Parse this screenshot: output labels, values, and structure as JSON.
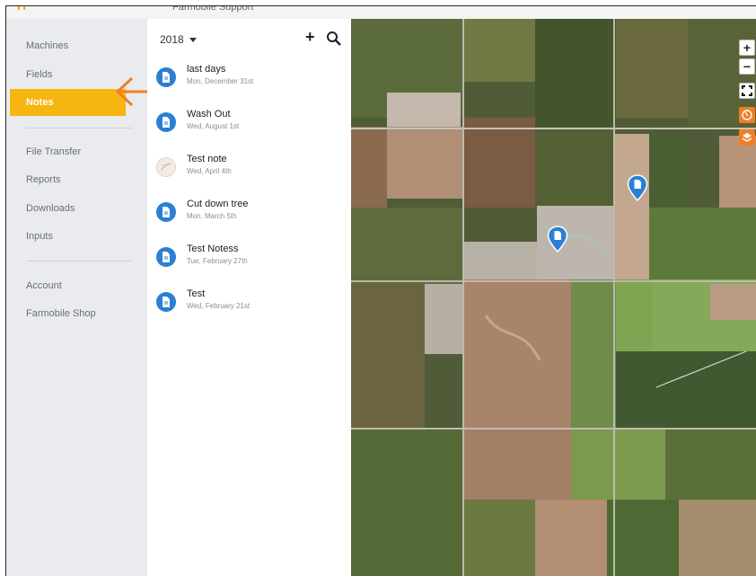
{
  "app": {
    "header_title": "Farmobile Support"
  },
  "sidebar": {
    "items": [
      {
        "label": "Machines"
      },
      {
        "label": "Fields"
      },
      {
        "label": "Notes"
      },
      {
        "label": "File Transfer"
      },
      {
        "label": "Reports"
      },
      {
        "label": "Downloads"
      },
      {
        "label": "Inputs"
      },
      {
        "label": "Account"
      },
      {
        "label": "Farmobile Shop"
      }
    ],
    "active_item": "Notes"
  },
  "notes_panel": {
    "year": "2018",
    "add_label": "+",
    "notes": [
      {
        "title": "last days",
        "date": "Mon, December 31st"
      },
      {
        "title": "Wash Out",
        "date": "Wed, August 1st"
      },
      {
        "title": "Test note",
        "date": "Wed, April 4th"
      },
      {
        "title": "Cut down tree",
        "date": "Mon, March 5th"
      },
      {
        "title": "Test Notess",
        "date": "Tue, February 27th"
      },
      {
        "title": "Test",
        "date": "Wed, February 21st"
      }
    ]
  },
  "map": {
    "controls": {
      "zoom_in": "+",
      "zoom_out": "−"
    },
    "pins": 2
  },
  "colors": {
    "accent": "#f7b512",
    "note_icon": "#2b7fd4",
    "control_orange": "#f07f24"
  }
}
